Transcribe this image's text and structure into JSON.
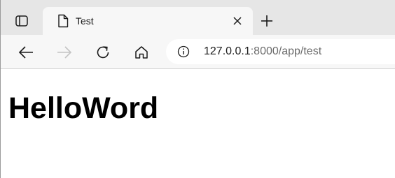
{
  "browser": {
    "tab": {
      "title": "Test",
      "favicon": "document-icon"
    },
    "icons": {
      "tab_actions": "tab-actions-icon",
      "close": "close-icon",
      "new_tab": "plus-icon",
      "back": "back-arrow-icon",
      "forward": "forward-arrow-icon",
      "refresh": "refresh-icon",
      "home": "home-icon",
      "site_info": "info-icon"
    },
    "address_bar": {
      "host": "127.0.0.1",
      "rest": ":8000/app/test"
    }
  },
  "page": {
    "heading": "HelloWord"
  },
  "colors": {
    "tabstrip_bg": "#e6e6e6",
    "toolbar_bg": "#f7f7f7",
    "disabled_icon": "#c4c4c4",
    "icon": "#1a1a1a"
  }
}
